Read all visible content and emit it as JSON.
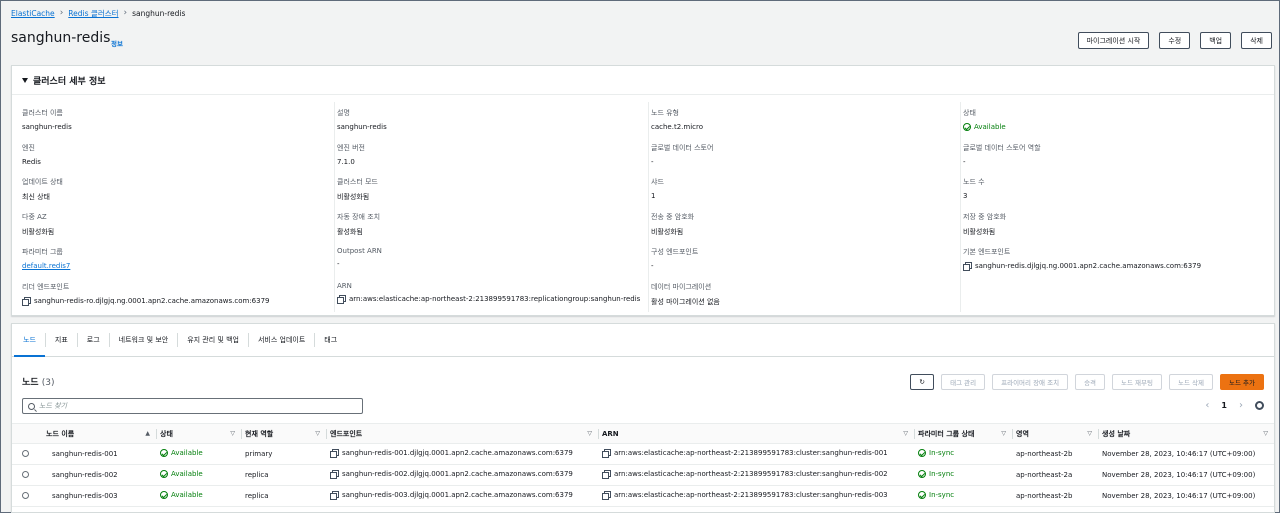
{
  "breadcrumb": {
    "root": "ElastiCache",
    "parent": "Redis 클러스터",
    "current": "sanghun-redis"
  },
  "page": {
    "title": "sanghun-redis",
    "info": "정보"
  },
  "header_actions": {
    "migrate": "마이그레이션 시작",
    "modify": "수정",
    "backup": "백업",
    "delete": "삭제"
  },
  "details": {
    "title": "클러스터 세부 정보",
    "fields": {
      "cluster_name": {
        "label": "클러스터 이름",
        "value": "sanghun-redis"
      },
      "description": {
        "label": "설명",
        "value": "sanghun-redis"
      },
      "node_type": {
        "label": "노드 유형",
        "value": "cache.t2.micro"
      },
      "status": {
        "label": "상태",
        "value": "Available"
      },
      "engine": {
        "label": "엔진",
        "value": "Redis"
      },
      "engine_version": {
        "label": "엔진 버전",
        "value": "7.1.0"
      },
      "global_datastore": {
        "label": "글로벌 데이터 스토어",
        "value": "-"
      },
      "global_datastore_role": {
        "label": "글로벌 데이터 스토어 역할",
        "value": "-"
      },
      "update_status": {
        "label": "업데이트 상태",
        "value": "최신 상태"
      },
      "cluster_mode": {
        "label": "클러스터 모드",
        "value": "비활성화됨"
      },
      "shards": {
        "label": "샤드",
        "value": "1"
      },
      "node_count": {
        "label": "노드 수",
        "value": "3"
      },
      "multi_az": {
        "label": "다중 AZ",
        "value": "비활성화됨"
      },
      "auto_failover": {
        "label": "자동 장애 조치",
        "value": "활성화됨"
      },
      "transit_encryption": {
        "label": "전송 중 암호화",
        "value": "비활성화됨"
      },
      "at_rest_encryption": {
        "label": "저장 중 암호화",
        "value": "비활성화됨"
      },
      "parameter_group": {
        "label": "파라미터 그룹",
        "value": "default.redis7"
      },
      "outpost_arn": {
        "label": "Outpost ARN",
        "value": "-"
      },
      "config_endpoint": {
        "label": "구성 엔드포인트",
        "value": "-"
      },
      "primary_endpoint": {
        "label": "기본 엔드포인트",
        "value": "sanghun-redis.djlgjq.ng.0001.apn2.cache.amazonaws.com:6379"
      },
      "reader_endpoint": {
        "label": "리더 엔드포인트",
        "value": "sanghun-redis-ro.djlgjq.ng.0001.apn2.cache.amazonaws.com:6379"
      },
      "arn": {
        "label": "ARN",
        "value": "arn:aws:elasticache:ap-northeast-2:213899591783:replicationgroup:sanghun-redis"
      },
      "data_migration": {
        "label": "데이터 마이그레이션",
        "value": "활성 마이그레이션 없음"
      }
    }
  },
  "tabs": [
    "노드",
    "지표",
    "로그",
    "네트워크 및 보안",
    "유지 관리 및 백업",
    "서비스 업데이트",
    "태그"
  ],
  "nodes": {
    "title": "노드",
    "count": "(3)",
    "actions": {
      "manage_tags": "태그 관리",
      "failover": "프라이머리 장애 조치",
      "promote": "승격",
      "reboot": "노드 재부팅",
      "delete": "노드 삭제",
      "add": "노드 추가"
    },
    "search_placeholder": "노드 찾기",
    "page": "1",
    "columns": [
      "노드 이름",
      "상태",
      "현재 역할",
      "엔드포인트",
      "ARN",
      "파라미터 그룹 상태",
      "영역",
      "생성 날짜"
    ],
    "rows": [
      {
        "name": "sanghun-redis-001",
        "status": "Available",
        "role": "primary",
        "endpoint": "sanghun-redis-001.djlgjq.0001.apn2.cache.amazonaws.com:6379",
        "arn": "arn:aws:elasticache:ap-northeast-2:213899591783:cluster:sanghun-redis-001",
        "param_status": "In-sync",
        "zone": "ap-northeast-2b",
        "created": "November 28, 2023, 10:46:17 (UTC+09:00)"
      },
      {
        "name": "sanghun-redis-002",
        "status": "Available",
        "role": "replica",
        "endpoint": "sanghun-redis-002.djlgjq.0001.apn2.cache.amazonaws.com:6379",
        "arn": "arn:aws:elasticache:ap-northeast-2:213899591783:cluster:sanghun-redis-002",
        "param_status": "In-sync",
        "zone": "ap-northeast-2a",
        "created": "November 28, 2023, 10:46:17 (UTC+09:00)"
      },
      {
        "name": "sanghun-redis-003",
        "status": "Available",
        "role": "replica",
        "endpoint": "sanghun-redis-003.djlgjq.0001.apn2.cache.amazonaws.com:6379",
        "arn": "arn:aws:elasticache:ap-northeast-2:213899591783:cluster:sanghun-redis-003",
        "param_status": "In-sync",
        "zone": "ap-northeast-2b",
        "created": "November 28, 2023, 10:46:17 (UTC+09:00)"
      }
    ]
  }
}
